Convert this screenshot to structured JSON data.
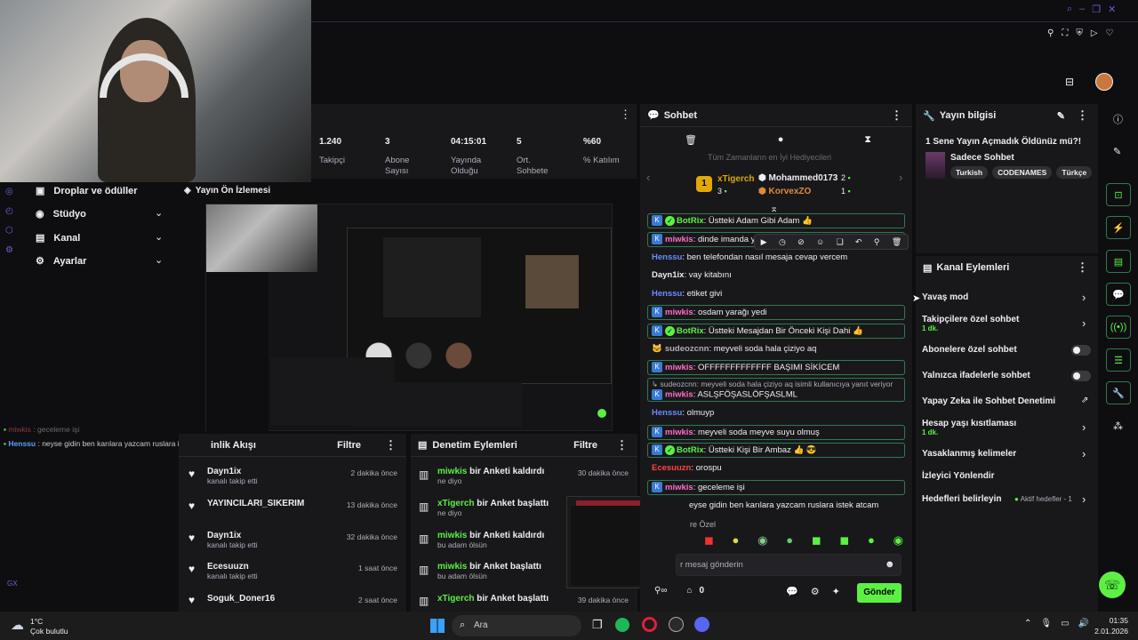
{
  "topbar": {
    "right_icons": [
      "search-icon",
      "minimize-icon",
      "window-icon",
      "close-icon"
    ]
  },
  "stats": [
    {
      "value": "1.240",
      "label": "Takipçi"
    },
    {
      "value": "3",
      "label": "Abone Sayısı"
    },
    {
      "value": "04:15:01",
      "label": "Yayında Olduğu"
    },
    {
      "value": "5",
      "label": "Ort. Sohbete"
    },
    {
      "value": "%60",
      "label": "% Katılım"
    }
  ],
  "sidebar": {
    "items": [
      {
        "label": "Droplar ve ödüller",
        "icon": "gift-icon"
      },
      {
        "label": "Stüdyo",
        "icon": "studio-icon"
      },
      {
        "label": "Kanal",
        "icon": "channel-icon"
      },
      {
        "label": "Ayarlar",
        "icon": "gear-icon"
      }
    ]
  },
  "preview": {
    "title": "Yayın Ön İzlemesi"
  },
  "overlay_chat": [
    {
      "user": "miwkis",
      "text": ": geceleme işi"
    },
    {
      "user": "Henssu",
      "text": ": neyse gidin ben karılara yazcam ruslara istek atcam"
    }
  ],
  "activity": {
    "title": "Etkinlik Akışı",
    "title_visible": "inlik Akışı",
    "filter": "Filtre",
    "items": [
      {
        "name": "Dayn1ix",
        "sub": "kanalı takip etti",
        "time": "2 dakika önce"
      },
      {
        "name": "YAYINCILARI_SIKERIM",
        "sub": "",
        "time": "13 dakika önce"
      },
      {
        "name": "Dayn1ix",
        "sub": "kanalı takip etti",
        "time": "32 dakika önce"
      },
      {
        "name": "Ecesuuzn",
        "sub": "kanalı takip etti",
        "time": "1 saat önce"
      },
      {
        "name": "Soguk_Doner16",
        "sub": "",
        "time": "2 saat önce"
      }
    ]
  },
  "moderation": {
    "title": "Denetim Eylemleri",
    "filter": "Filtre",
    "items": [
      {
        "user": "miwkis",
        "action": "bir Anketi kaldırdı",
        "sub": "ne diyo",
        "time": "30 dakika önce"
      },
      {
        "user": "xTigerch",
        "action": "bir Anket başlattı",
        "sub": "ne diyo",
        "time": ""
      },
      {
        "user": "miwkis",
        "action": "bir Anketi kaldırdı",
        "sub": "bu adam ölsün",
        "time": ""
      },
      {
        "user": "miwkis",
        "action": "bir Anket başlattı",
        "sub": "bu adam ölsün",
        "time": ""
      },
      {
        "user": "xTigerch",
        "action": "bir Anket başlattı",
        "sub": "",
        "time": "39 dakika önce"
      }
    ]
  },
  "chat": {
    "title": "Sohbet",
    "gifters_title": "Tüm Zamanların en İyi Hediyecileri",
    "gifters": [
      {
        "rank": "1",
        "name": "xTigerch",
        "count": "3"
      },
      {
        "rank": "",
        "name": "Mohammed0173",
        "count": "2"
      },
      {
        "rank": "",
        "name": "KorvexZO",
        "count": "1"
      }
    ],
    "messages": [
      {
        "user": "BotRix",
        "text": ": Üstteki Adam Gibi Adam 👍",
        "style": "box",
        "color": "u-green",
        "badges": "kick-verif"
      },
      {
        "user": "miwkis",
        "text": ": dinde imanda ye",
        "style": "box",
        "color": "u-pink",
        "badges": "kick"
      },
      {
        "user": "Henssu",
        "text": ": ben telefondan nasıl mesaja cevap vercem",
        "style": "plain",
        "color": "u-blue",
        "badges": ""
      },
      {
        "user": "Dayn1ix",
        "text": ": vay kitabını",
        "style": "plain",
        "color": "u-white",
        "badges": ""
      },
      {
        "user": "Henssu",
        "text": ": etiket givi",
        "style": "plain",
        "color": "u-blue",
        "badges": ""
      },
      {
        "user": "miwkis",
        "text": ": osdam yarağı yedi",
        "style": "box",
        "color": "u-pink",
        "badges": "kick"
      },
      {
        "user": "BotRix",
        "text": ": Üstteki Mesajdan Bir Önceki Kişi Dahi 👍",
        "style": "box",
        "color": "u-green",
        "badges": "kick-verif"
      },
      {
        "user": "sudeozcnn",
        "text": ": meyveli soda hala çiziyo aq",
        "style": "plain",
        "color": "u-gray",
        "badges": ""
      },
      {
        "user": "miwkis",
        "text": ": OFFFFFFFFFFFFF BAŞIMI SİKİCEM",
        "style": "box",
        "color": "u-pink",
        "badges": "kick"
      },
      {
        "user": "miwkis",
        "text": ": ASLŞFÖŞASLÖFŞASLML",
        "style": "box",
        "color": "u-pink",
        "badges": "kick",
        "reply": "↳ sudeozcnn: meyveli soda hala çiziyo aq isimli kullanıcıya yanıt veriyor"
      },
      {
        "user": "Henssu",
        "text": ": olmuyp",
        "style": "plain",
        "color": "u-blue",
        "badges": ""
      },
      {
        "user": "miwkis",
        "text": ": meyveli soda meyve suyu olmuş",
        "style": "box",
        "color": "u-pink",
        "badges": "kick"
      },
      {
        "user": "BotRix",
        "text": ": Üstteki Kişi Bir Ambaz 👍 😎",
        "style": "box",
        "color": "u-green",
        "badges": "kick-verif"
      },
      {
        "user": "Ecesuuzn",
        "text": ": orospu",
        "style": "plain",
        "color": "u-red",
        "badges": ""
      },
      {
        "user": "miwkis",
        "text": ": geceleme işi",
        "style": "box",
        "color": "u-pink",
        "badges": "kick"
      },
      {
        "user": "",
        "text": "eyse gidin ben karılara yazcam ruslara istek atcam",
        "style": "plain",
        "color": "u-blue",
        "badges": ""
      }
    ],
    "emote_label": "re Özel",
    "input_placeholder": "r mesaj gönderin",
    "count": "0",
    "send_label": "Gönder"
  },
  "stream_info": {
    "title": "Yayın bilgisi",
    "stream_title": "1 Sene Yayın Açmadık Öldünüz mü?!",
    "category": "Sadece Sohbet",
    "tags": [
      "Turkish",
      "CODENAMES",
      "Türkçe"
    ]
  },
  "channel_actions": {
    "title": "Kanal Eylemleri",
    "items": [
      {
        "label": "Yavaş mod",
        "sub": "",
        "control": "chevron"
      },
      {
        "label": "Takipçilere özel sohbet",
        "sub": "1 dk.",
        "control": "chevron"
      },
      {
        "label": "Abonelere özel sohbet",
        "sub": "",
        "control": "toggle"
      },
      {
        "label": "Yalnızca ifadelerle sohbet",
        "sub": "",
        "control": "toggle"
      },
      {
        "label": "Yapay Zeka ile Sohbet Denetimi",
        "sub": "",
        "control": "external"
      },
      {
        "label": "Hesap yaşı kısıtlaması",
        "sub": "1 dk.",
        "control": "chevron"
      },
      {
        "label": "Yasaklanmış kelimeler",
        "sub": "",
        "control": "chevron"
      },
      {
        "label": "İzleyici Yönlendir",
        "sub": "",
        "control": "none"
      },
      {
        "label": "Hedefleri belirleyin",
        "sub": "",
        "control": "chevron",
        "extra": "Aktif hedefler - 1"
      }
    ]
  },
  "taskbar": {
    "weather_temp": "1°C",
    "weather_desc": "Çok bulutlu",
    "search_label": "Ara",
    "time": "01:35",
    "date": "2.01.2026"
  },
  "colors": {
    "accent": "#5cf044",
    "bg": "#0e0e10",
    "panel": "#18181b"
  }
}
